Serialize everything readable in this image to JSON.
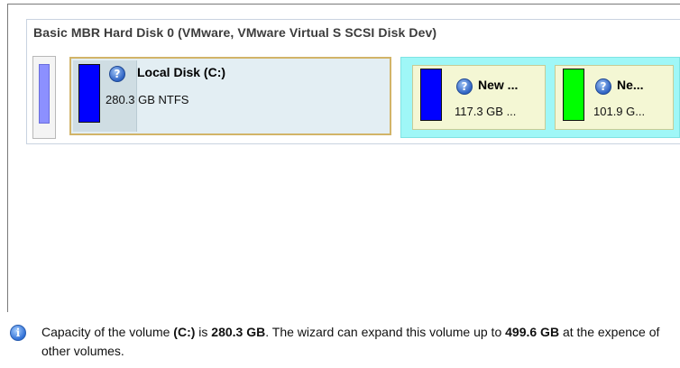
{
  "disk": {
    "title": "Basic MBR Hard Disk 0 (VMware, VMware Virtual S SCSI Disk Dev)"
  },
  "partitions": [
    {
      "name": "Local Disk (C:)",
      "size": "280.3 GB NTFS",
      "fill_color": "#0000ff",
      "selected": true
    },
    {
      "name": "New ...",
      "size": "117.3 GB ...",
      "fill_color": "#0000ff"
    },
    {
      "name": "Ne...",
      "size": "101.9 G...",
      "fill_color": "#00ff00"
    }
  ],
  "info": {
    "part1": "Capacity of the volume ",
    "volume": "(C:)",
    "part2": " is ",
    "capacity": "280.3 GB",
    "part3": ". The wizard can expand this volume up to ",
    "max": "499.6 GB",
    "part4": " at the expence of other volumes."
  },
  "colors": {
    "selected_border": "#d2b468",
    "extended_bg": "#9ff7f7",
    "disk_bar": "#8c90ff"
  },
  "icons": [
    "question-icon",
    "info-icon"
  ]
}
